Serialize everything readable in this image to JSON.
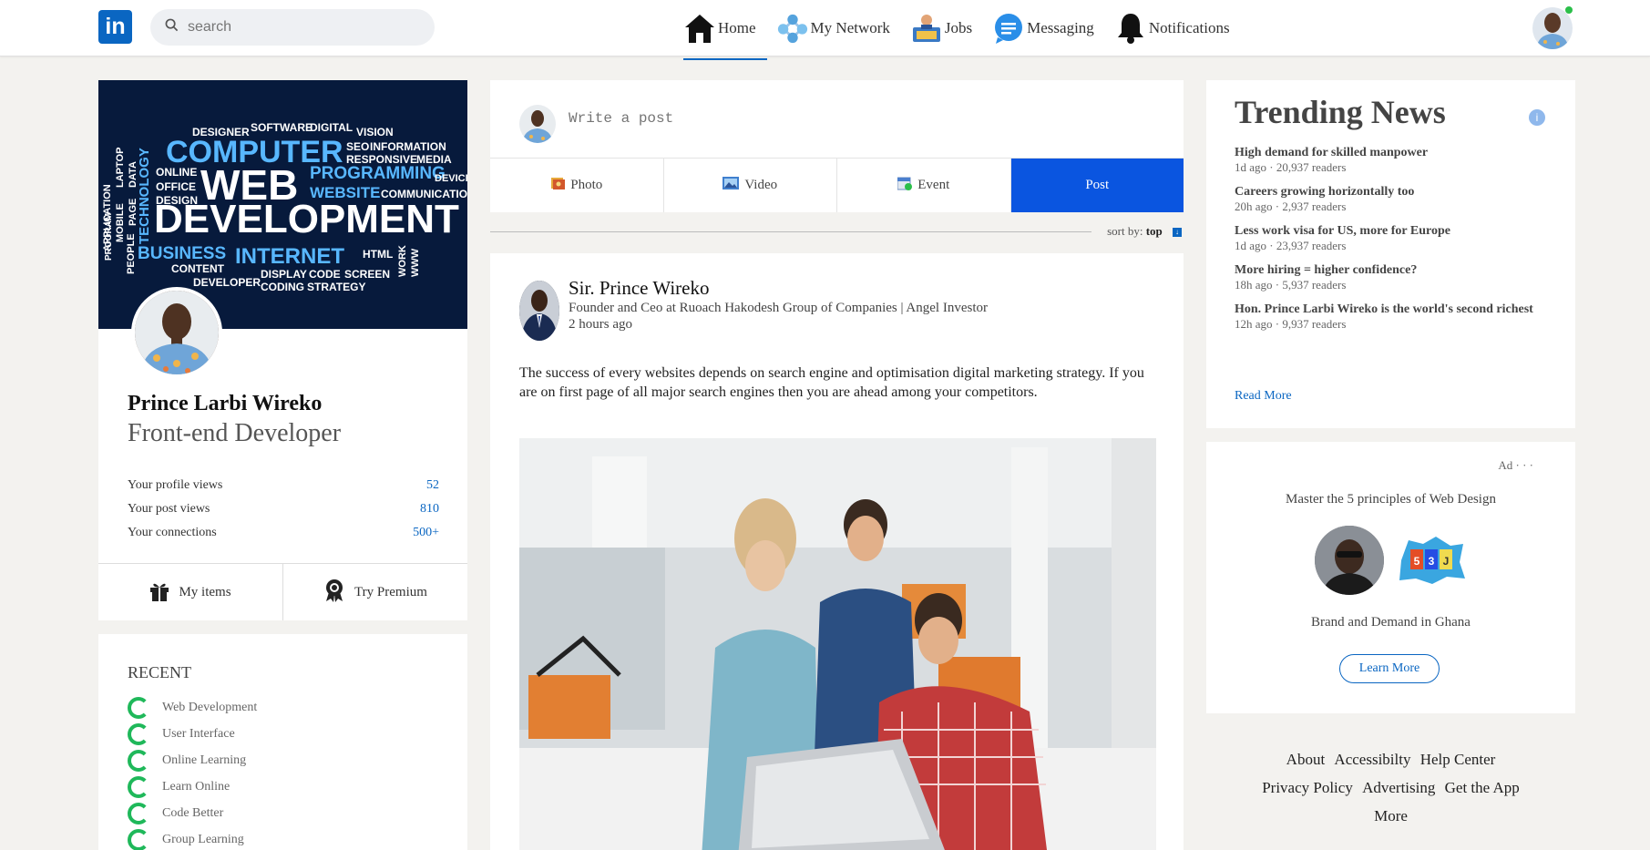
{
  "topbar": {
    "logo": "in",
    "search_placeholder": "search",
    "nav": [
      {
        "label": "Home",
        "icon": "home-icon",
        "active": true
      },
      {
        "label": "My Network",
        "icon": "network-icon"
      },
      {
        "label": "Jobs",
        "icon": "jobs-icon"
      },
      {
        "label": "Messaging",
        "icon": "messaging-icon"
      },
      {
        "label": "Notifications",
        "icon": "bell-icon"
      }
    ]
  },
  "profile": {
    "cover_words": [
      "DESIGNER",
      "SOFTWARE",
      "DIGITAL",
      "VISION",
      "COMPUTER",
      "SEO",
      "INFORMATION",
      "RESPONSIVE",
      "MEDIA",
      "ONLINE",
      "PROGRAMMING",
      "DEVICE",
      "OFFICE",
      "WEB",
      "WEBSITE",
      "COMMUNICATION",
      "DESIGN",
      "TECHNOLOGY",
      "APPLICATION",
      "MOBILE",
      "PAGE",
      "LAPTOP",
      "DATA",
      "DEVELOPMENT",
      "PROGRAM",
      "PEOPLE",
      "BUSINESS",
      "INTERNET",
      "HTML",
      "WORK",
      "WWW",
      "CONTENT",
      "DISPLAY",
      "CODE",
      "SCREEN",
      "DEVELOPER",
      "CODING",
      "STRATEGY"
    ],
    "name": "Prince Larbi Wireko",
    "title": "Front-end Developer",
    "stats": [
      {
        "label": "Your profile views",
        "value": "52"
      },
      {
        "label": "Your post views",
        "value": "810"
      },
      {
        "label": "Your connections",
        "value": "500+"
      }
    ],
    "actions": {
      "my_items": "My items",
      "try_premium": "Try Premium"
    }
  },
  "recent": {
    "title": "RECENT",
    "items": [
      "Web Development",
      "User Interface",
      "Online Learning",
      "Learn Online",
      "Code Better",
      "Group Learning"
    ]
  },
  "composer": {
    "placeholder": "Write a post",
    "actions": {
      "photo": "Photo",
      "video": "Video",
      "event": "Event",
      "post": "Post"
    }
  },
  "sort": {
    "label": "sort by:",
    "value": "top"
  },
  "post": {
    "author": "Sir. Prince Wireko",
    "subtitle": "Founder and Ceo at Ruoach Hakodesh Group of Companies | Angel Investor",
    "time": "2 hours ago",
    "text": "The success of every websites depends on search engine and optimisation digital marketing strategy. If you are on first page of all major search engines then you are ahead among your competitors."
  },
  "news": {
    "title": "Trending News",
    "info": "i",
    "items": [
      {
        "headline": "High demand for skilled manpower",
        "meta": "1d ago · 20,937 readers"
      },
      {
        "headline": "Careers growing horizontally too",
        "meta": "20h ago · 2,937 readers"
      },
      {
        "headline": "Less work visa for US, more for Europe",
        "meta": "1d ago · 23,937 readers"
      },
      {
        "headline": "More hiring = higher confidence?",
        "meta": "18h ago · 5,937 readers"
      },
      {
        "headline": "Hon. Prince Larbi Wireko is the world's second richest",
        "meta": "12h ago · 9,937 readers"
      }
    ],
    "read_more": "Read More"
  },
  "ad": {
    "label": "Ad · · ·",
    "text": "Master the 5 principles of Web Design",
    "caption": "Brand and Demand in Ghana",
    "button": "Learn More"
  },
  "footer": {
    "links": [
      "About",
      "Accessibilty",
      "Help Center",
      "Privacy Policy",
      "Advertising",
      "Get the App",
      "More"
    ]
  },
  "colors": {
    "accent": "#0a66c2",
    "post_button": "#0a55e0",
    "online": "#2bbf4a",
    "ring": "#1fb85a"
  }
}
